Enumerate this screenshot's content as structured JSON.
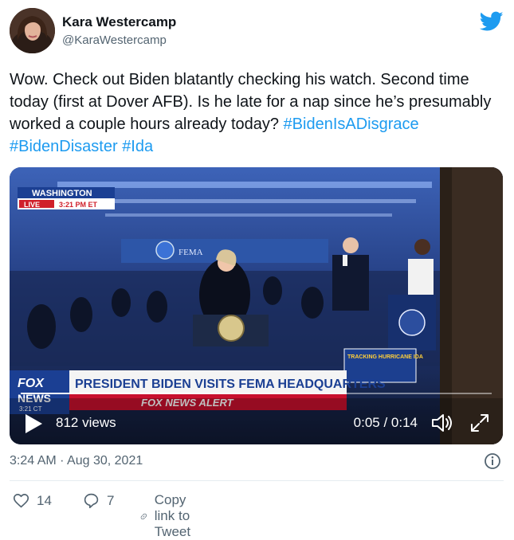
{
  "author": {
    "display_name": "Kara Westercamp",
    "handle": "@KaraWestercamp",
    "avatar_icon": "avatar-photo"
  },
  "brand_icon": "twitter-bird-icon",
  "tweet": {
    "text": "Wow. Check out Biden blatantly checking his watch. Second time today (first at Dover AFB). Is he late for a nap since he’s presumably worked a couple hours already today? ",
    "hashtags": [
      "#BidenIsADisgrace",
      "#BidenDisaster",
      "#Ida"
    ]
  },
  "video": {
    "overlay": {
      "location": "WASHINGTON",
      "live": "LIVE",
      "time": "3:21 PM ET",
      "headline": "PRESIDENT BIDEN VISITS FEMA HEADQUARTERS",
      "alert": "FOX NEWS ALERT",
      "tracking": "TRACKING HURRICANE IDA",
      "logo_top": "FOX",
      "logo_bottom": "NEWS",
      "logo_time": "3:21 CT",
      "sign": "FEMA"
    },
    "views": "812 views",
    "timecode": "0:05 / 0:14",
    "progress": 0.36
  },
  "timestamp": "3:24 AM · Aug 30, 2021",
  "actions": {
    "likes": "14",
    "replies": "7",
    "copy_link": "Copy link to Tweet"
  },
  "colors": {
    "accent": "#1d9bf0",
    "text": "#0f1419",
    "secondary": "#536471"
  }
}
